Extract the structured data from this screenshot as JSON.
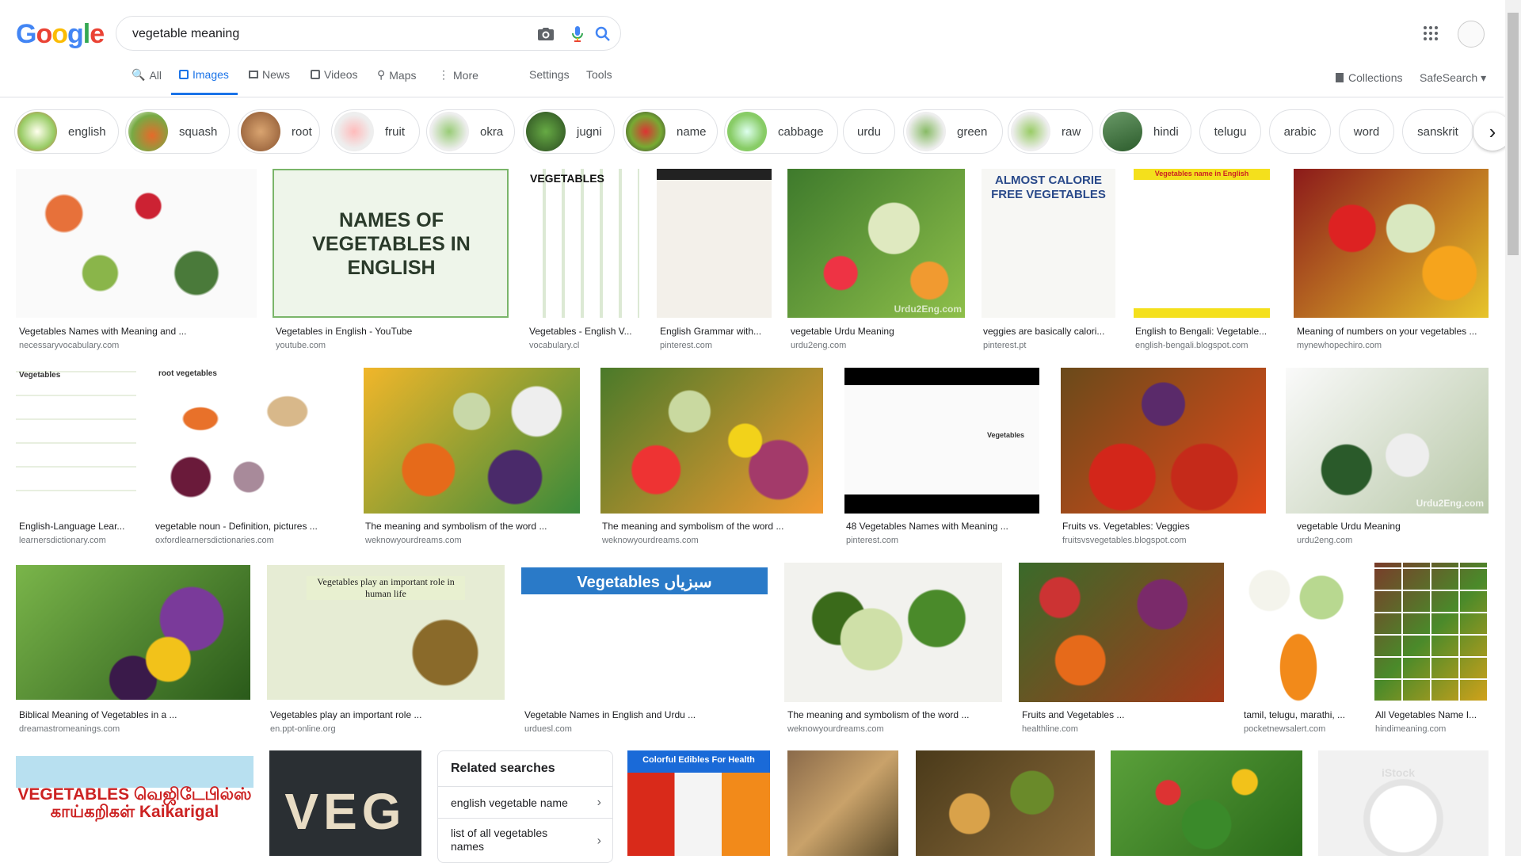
{
  "header": {
    "logo": "Google",
    "query": "vegetable meaning",
    "tabs": [
      "All",
      "Images",
      "News",
      "Videos",
      "Maps",
      "More"
    ],
    "settings": "Settings",
    "tools": "Tools",
    "collections": "Collections",
    "safesearch": "SafeSearch"
  },
  "chips": [
    "english",
    "squash",
    "root",
    "fruit",
    "okra",
    "jugni",
    "name",
    "cabbage",
    "urdu",
    "green",
    "raw",
    "hindi",
    "telugu",
    "arabic",
    "word",
    "sanskrit"
  ],
  "results": [
    {
      "title": "Vegetables Names with Meaning and ...",
      "source": "necessaryvocabulary.com"
    },
    {
      "title": "Vegetables in English - YouTube",
      "source": "youtube.com",
      "overlay": "NAMES OF VEGETABLES IN ENGLISH"
    },
    {
      "title": "Vegetables - English V...",
      "source": "vocabulary.cl",
      "overlay": "VEGETABLES"
    },
    {
      "title": "English Grammar with...",
      "source": "pinterest.com"
    },
    {
      "title": "vegetable Urdu Meaning",
      "source": "urdu2eng.com",
      "overlay": "Urdu2Eng.com"
    },
    {
      "title": "veggies are basically calori...",
      "source": "pinterest.pt",
      "overlay": "ALMOST CALORIE FREE VEGETABLES"
    },
    {
      "title": "English to Bengali: Vegetable...",
      "source": "english-bengali.blogspot.com",
      "overlay": "Vegetables name in English"
    },
    {
      "title": "Meaning of numbers on your vegetables ...",
      "source": "mynewhopechiro.com"
    },
    {
      "title": "English-Language Lear...",
      "source": "learnersdictionary.com",
      "overlay": "Vegetables"
    },
    {
      "title": "vegetable noun - Definition, pictures ...",
      "source": "oxfordlearnersdictionaries.com",
      "overlay": "root vegetables"
    },
    {
      "title": "The meaning and symbolism of the word ...",
      "source": "weknowyourdreams.com"
    },
    {
      "title": "The meaning and symbolism of the word ...",
      "source": "weknowyourdreams.com"
    },
    {
      "title": "48 Vegetables Names with Meaning ...",
      "source": "pinterest.com",
      "overlay": "Vegetables"
    },
    {
      "title": "Fruits vs. Vegetables: Veggies",
      "source": "fruitsvsvegetables.blogspot.com"
    },
    {
      "title": "vegetable Urdu Meaning",
      "source": "urdu2eng.com",
      "overlay": "Urdu2Eng.com"
    },
    {
      "title": "Biblical Meaning of Vegetables in a ...",
      "source": "dreamastromeanings.com"
    },
    {
      "title": "Vegetables play an important role ...",
      "source": "en.ppt-online.org",
      "overlay": "Vegetables play an important role in human life"
    },
    {
      "title": "Vegetable Names in English and Urdu ...",
      "source": "urduesl.com",
      "overlay": "Vegetables سبزیاں"
    },
    {
      "title": "The meaning and symbolism of the word ...",
      "source": "weknowyourdreams.com"
    },
    {
      "title": "Fruits and Vegetables ...",
      "source": "healthline.com"
    },
    {
      "title": "tamil, telugu, marathi, ...",
      "source": "pocketnewsalert.com"
    },
    {
      "title": "All Vegetables Name I...",
      "source": "hindimeaning.com"
    },
    {
      "overlay": "VEGETABLES வெஜிடேபில்ஸ் காய்கறிகள் Kaikarigal"
    },
    {
      "overlay": "VEG"
    },
    {
      "overlay": "Colorful Edibles For Health"
    },
    {},
    {},
    {},
    {
      "overlay": "iStock"
    }
  ],
  "related": {
    "title": "Related searches",
    "items": [
      "english vegetable name",
      "list of all vegetables names"
    ]
  }
}
